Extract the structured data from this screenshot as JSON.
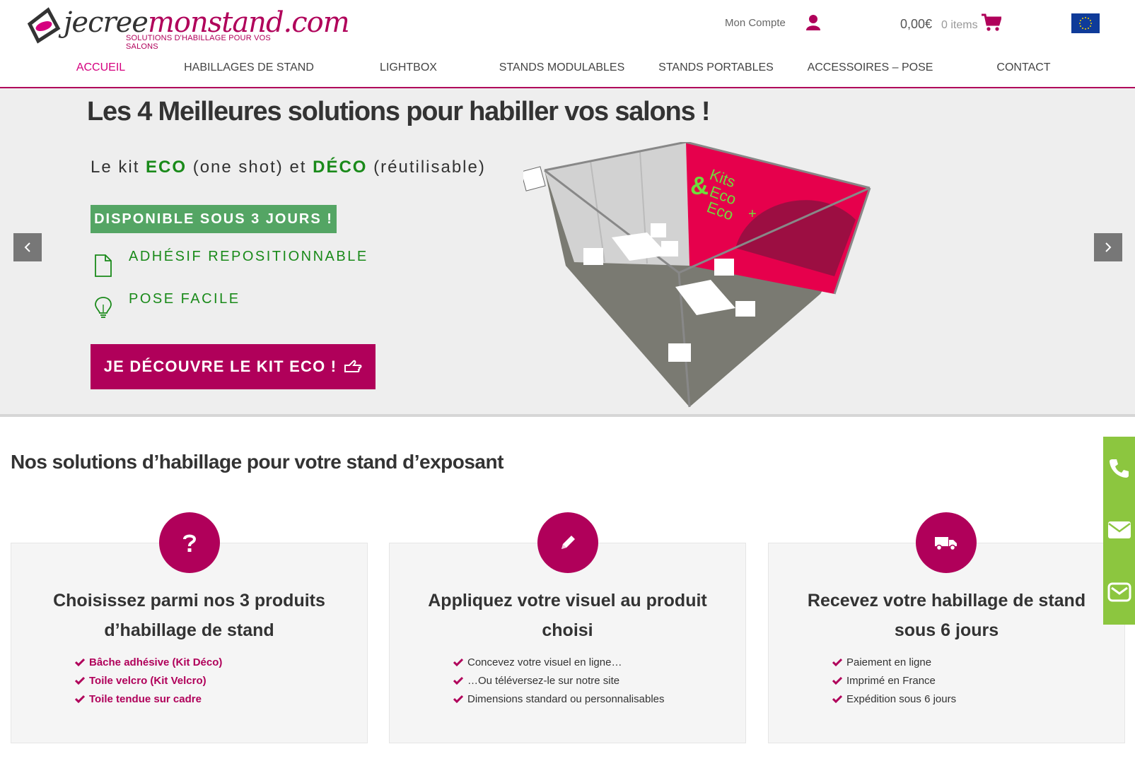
{
  "header": {
    "logo_text_a": "jecree",
    "logo_text_b": "monstand.com",
    "logo_tagline": "SOLUTIONS D'HABILLAGE POUR VOS SALONS",
    "account_label": "Mon Compte",
    "cart_total": "0,00€",
    "cart_items": "0 items"
  },
  "nav": {
    "items": [
      {
        "label": "ACCUEIL",
        "active": true
      },
      {
        "label": "HABILLAGES DE STAND",
        "active": false
      },
      {
        "label": "LIGHTBOX",
        "active": false
      },
      {
        "label": "STANDS MODULABLES",
        "active": false
      },
      {
        "label": "STANDS PORTABLES",
        "active": false
      },
      {
        "label": "ACCESSOIRES – POSE",
        "active": false
      },
      {
        "label": "CONTACT",
        "active": false
      }
    ]
  },
  "hero": {
    "title": "Les 4 Meilleures solutions pour habiller vos salons !",
    "kit_line": {
      "p1": "Le kit ",
      "eco": "ECO",
      "p2": " (one shot) et ",
      "deco": "DÉCO",
      "p3": " (réutilisable)"
    },
    "availability": "DISPONIBLE SOUS 3 JOURS !",
    "features": [
      "ADHÉSIF REPOSITIONNABLE",
      "POSE FACILE"
    ],
    "cta_label": "JE DÉCOUVRE LE KIT ECO !",
    "image_text": {
      "kits": "Kits",
      "eco1": "Eco",
      "eco2": "Eco",
      "amp": "&",
      "plus": "+"
    }
  },
  "solutions": {
    "title": "Nos solutions d’habillage pour votre stand d’exposant",
    "cards": [
      {
        "icon": "question-icon",
        "title": "Choisissez parmi nos 3 produits d’habillage de stand",
        "items": [
          "Bâche adhésive (Kit Déco)",
          "Toile velcro (Kit Velcro)",
          "Toile tendue sur cadre"
        ]
      },
      {
        "icon": "pencil-icon",
        "title": "Appliquez votre visuel au produit choisi",
        "items": [
          "Concevez votre visuel en ligne…",
          "…Ou téléversez-le sur notre site",
          "Dimensions standard ou personnalisables"
        ]
      },
      {
        "icon": "truck-icon",
        "title": "Recevez votre habillage de stand sous 6 jours",
        "items": [
          "Paiement en ligne",
          "Imprimé en France",
          "Expédition sous 6 jours"
        ]
      }
    ]
  },
  "colors": {
    "brand": "#b0005a",
    "accent_pink": "#d5007f",
    "green": "#1a8a1a",
    "badge_green": "#54a564",
    "side_green": "#8cc63f"
  }
}
